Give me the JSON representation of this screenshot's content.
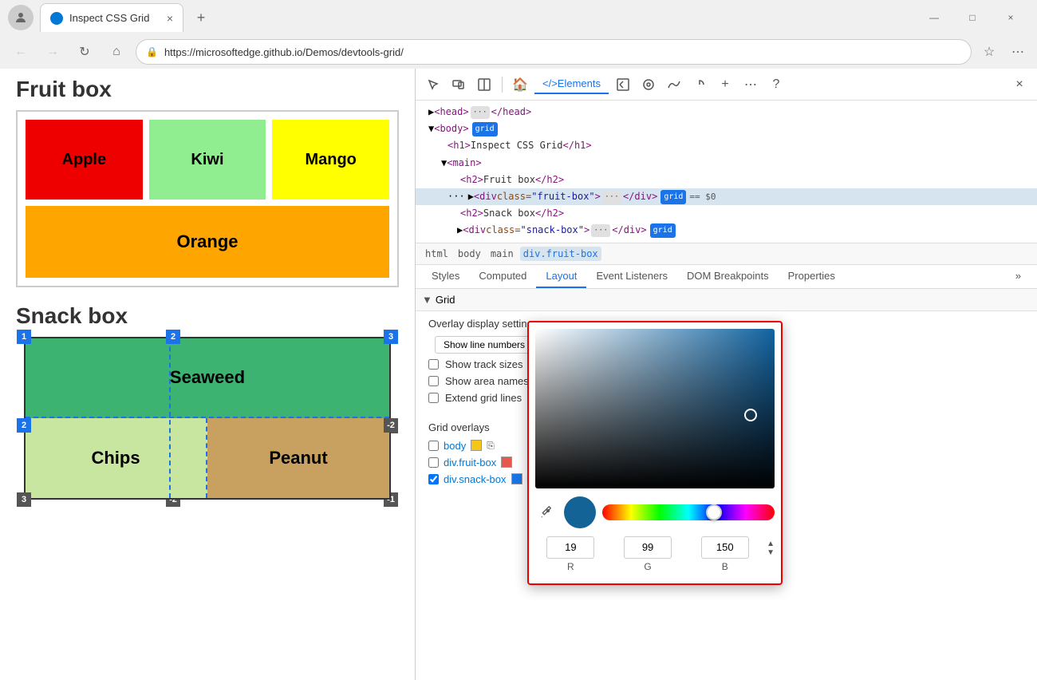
{
  "browser": {
    "tab_title": "Inspect CSS Grid",
    "tab_close": "×",
    "tab_new": "+",
    "url": "https://microsoftedge.github.io/Demos/devtools-grid/",
    "win_minimize": "—",
    "win_maximize": "□",
    "win_close": "×"
  },
  "page": {
    "fruit_title": "Fruit box",
    "snack_title": "Snack box",
    "fruits": [
      "Apple",
      "Kiwi",
      "Mango"
    ],
    "orange": "Orange",
    "seaweed": "Seaweed",
    "chips": "Chips",
    "peanut": "Peanut"
  },
  "devtools": {
    "toolbar_tabs": [
      "Elements"
    ],
    "dom": {
      "head": "<head>",
      "body": "<body>",
      "body_badge": "grid",
      "h1": "<h1>Inspect CSS Grid</h1>",
      "main": "<main>",
      "h2_fruit": "<h2>Fruit box</h2>",
      "div_fruit": "<div class=\"fruit-box\">",
      "div_fruit_badge": "grid",
      "div_fruit_eq": "== $0",
      "h2_snack": "<h2>Snack box</h2>",
      "div_snack": "<div class=\"snack-box\">",
      "div_snack_badge": "grid"
    },
    "breadcrumb": [
      "html",
      "body",
      "main",
      "div.fruit-box"
    ],
    "panels": {
      "styles": "Styles",
      "computed": "Computed",
      "layout": "Layout",
      "event_listeners": "Event Listeners",
      "dom_breakpoints": "DOM Breakpoints",
      "properties": "Properties",
      "more": "»"
    },
    "grid_section": "Grid",
    "overlay_settings_label": "Overlay display settings",
    "overlay_options": {
      "show_line_numbers": "Show line numbers",
      "show_track_sizes": "Show track sizes",
      "show_area_names": "Show area names",
      "extend_grid_lines": "Extend grid lines"
    },
    "grid_overlays_label": "Grid overlays",
    "grid_overlays": [
      {
        "label": "body",
        "color": "#f5c518",
        "checked": false
      },
      {
        "label": "div.fruit-box",
        "color": "#e8584a",
        "checked": false
      },
      {
        "label": "div.snack-box",
        "color": "#1a73e8",
        "checked": true
      }
    ]
  },
  "color_picker": {
    "r_value": "19",
    "g_value": "99",
    "b_value": "150",
    "r_label": "R",
    "g_label": "G",
    "b_label": "B"
  }
}
